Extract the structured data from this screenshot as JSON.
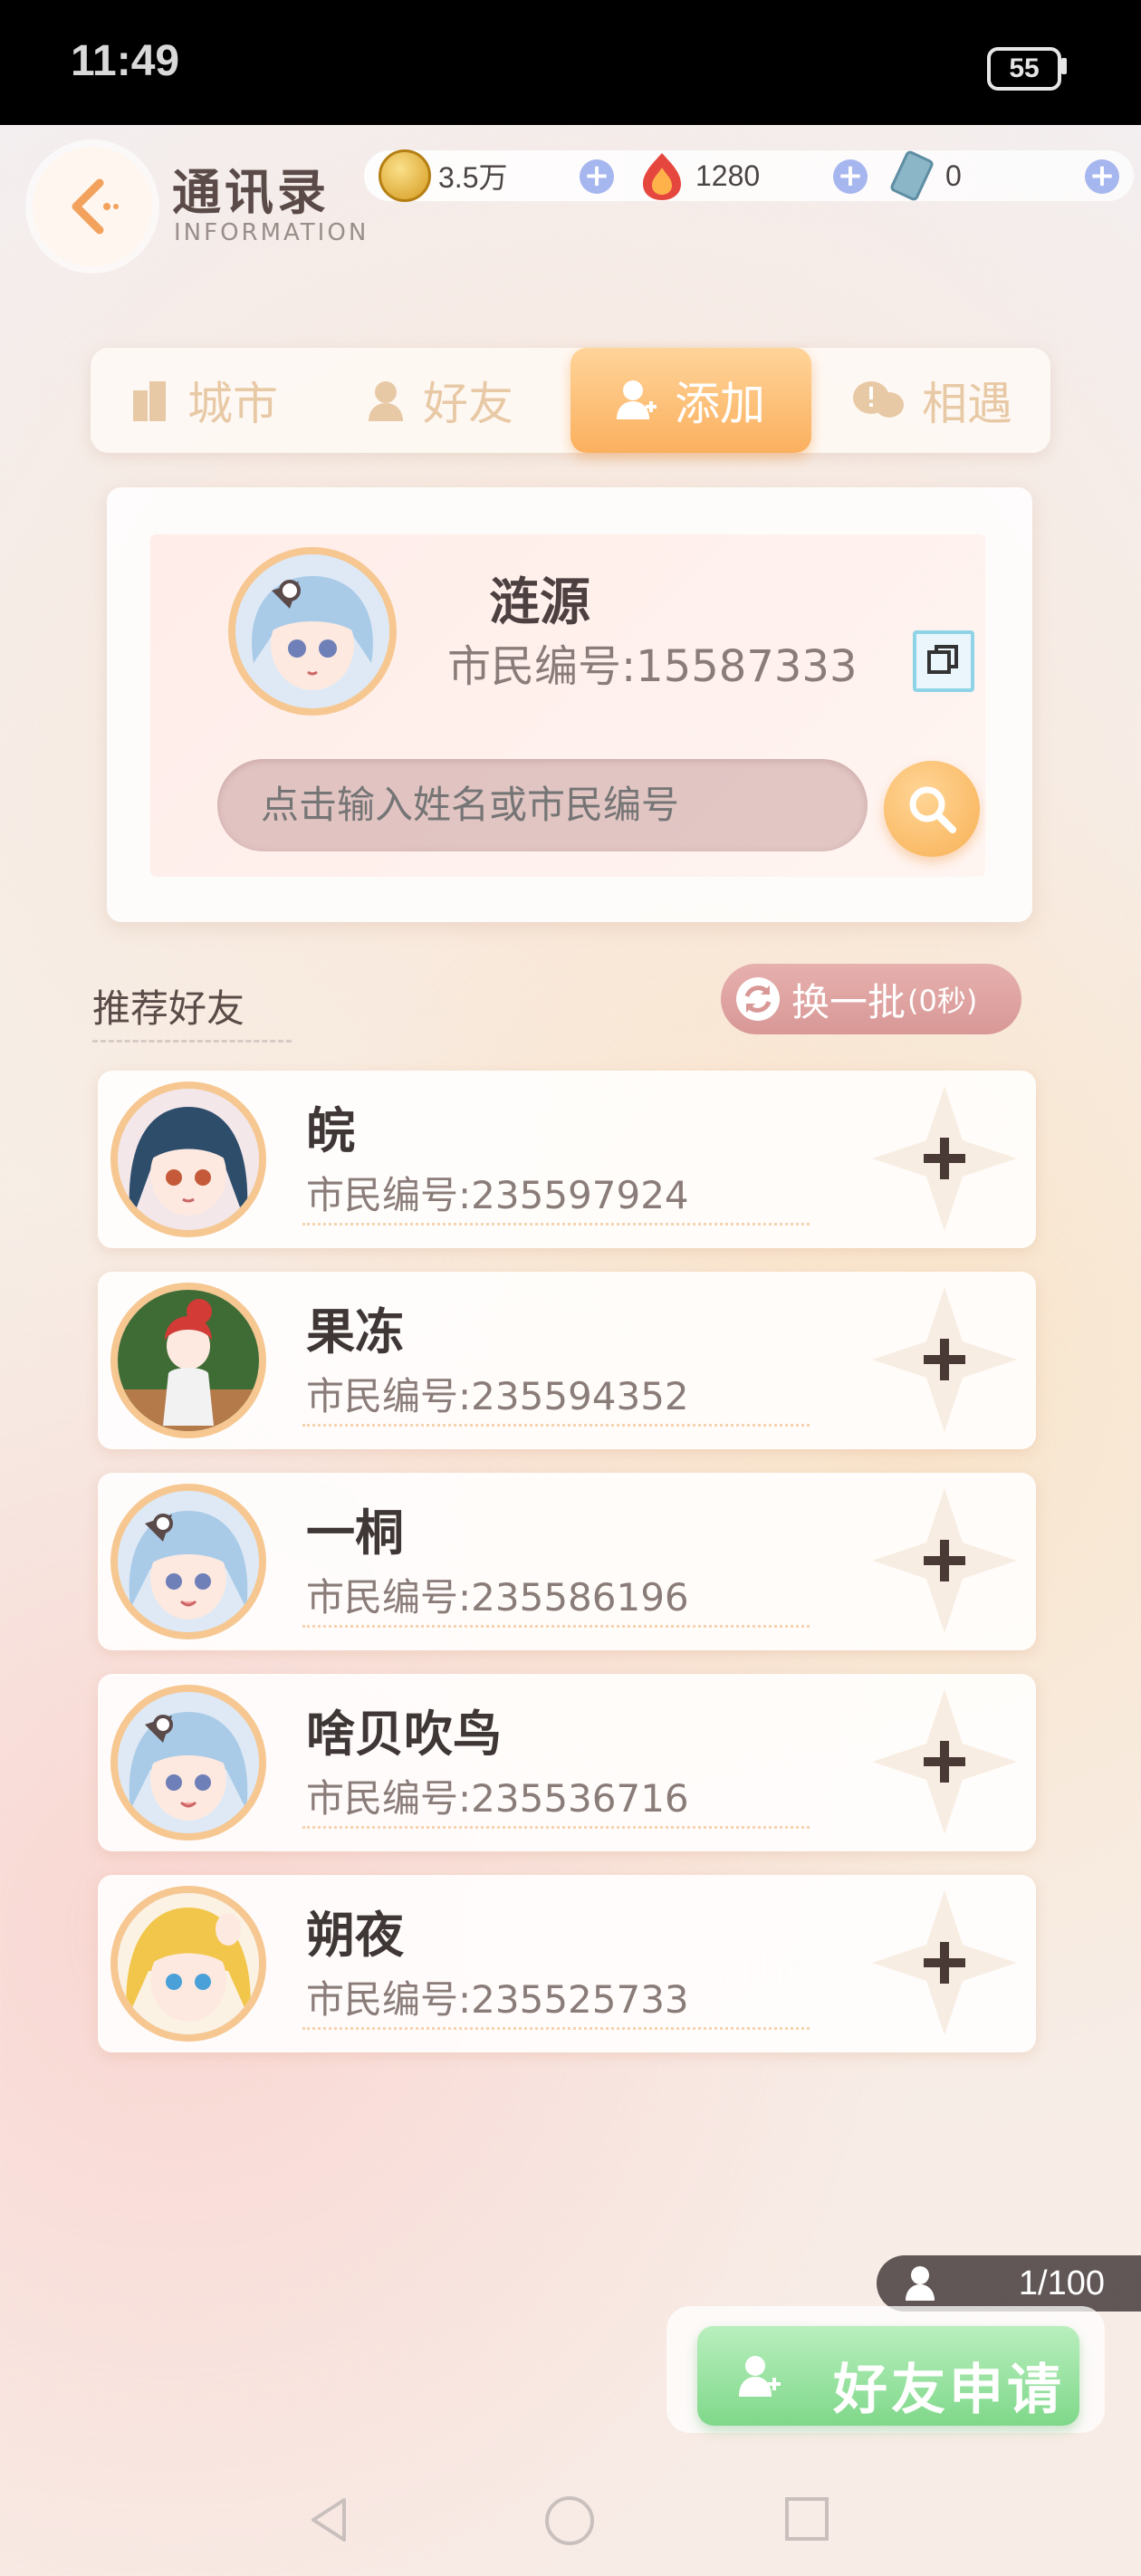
{
  "status": {
    "time": "11:49",
    "battery": "55"
  },
  "header": {
    "title": "通讯录",
    "subtitle": "INFORMATION"
  },
  "currencies": [
    {
      "name": "coin",
      "value": "3.5万",
      "color": "#e7b53a"
    },
    {
      "name": "crystal",
      "value": "1280",
      "color": "#e5473f"
    },
    {
      "name": "ticket",
      "value": "0",
      "color": "#8ab6c8"
    }
  ],
  "tabs": [
    {
      "label": "城市",
      "icon": "building-icon",
      "active": false
    },
    {
      "label": "好友",
      "icon": "friend-icon",
      "active": false
    },
    {
      "label": "添加",
      "icon": "add-user-icon",
      "active": true
    },
    {
      "label": "相遇",
      "icon": "chat-icon",
      "active": false
    }
  ],
  "profile": {
    "name": "涟源",
    "citizen_id": "市民编号:15587333"
  },
  "search": {
    "placeholder": "点击输入姓名或市民编号"
  },
  "recommend": {
    "title": "推荐好友",
    "refresh_label": "换一批",
    "refresh_sub": "(0秒)"
  },
  "friends": [
    {
      "name": "皖",
      "citizen_id": "市民编号:235597924",
      "avatar": "dark-hair-avatar",
      "hair": "#2e4d6b"
    },
    {
      "name": "果冻",
      "citizen_id": "市民编号:235594352",
      "avatar": "red-hair-avatar",
      "hair": "#d23b36"
    },
    {
      "name": "一桐",
      "citizen_id": "市民编号:235586196",
      "avatar": "blue-hair-avatar",
      "hair": "#a9cbe8"
    },
    {
      "name": "啥贝吹鸟",
      "citizen_id": "市民编号:235536716",
      "avatar": "blue-hair-avatar",
      "hair": "#a9cbe8"
    },
    {
      "name": "朔夜",
      "citizen_id": "市民编号:235525733",
      "avatar": "blonde-hair-avatar",
      "hair": "#f2c64a"
    }
  ],
  "requests": {
    "count": "1/100",
    "button_label": "好友申请"
  }
}
